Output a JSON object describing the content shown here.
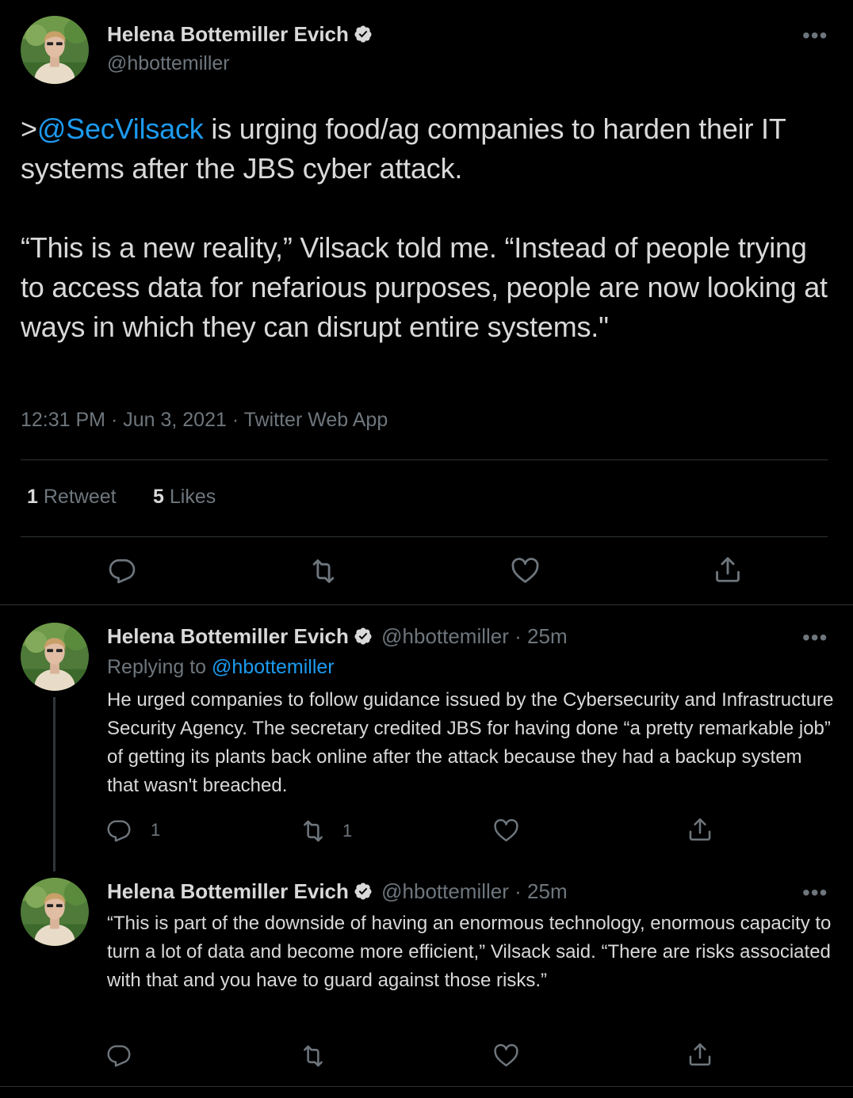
{
  "main_tweet": {
    "author_name": "Helena Bottemiller Evich",
    "handle": "@hbottemiller",
    "text_prefix": ">",
    "mention": "@SecVilsack",
    "text_line1_rest": " is urging food/ag companies to harden their IT systems after the JBS cyber attack.",
    "text_para2": "“This is a new reality,” Vilsack told me. “Instead of people trying to access data for nefarious purposes, people are now looking at ways in which they can disrupt entire systems.\"",
    "timestamp": "12:31 PM · Jun 3, 2021 · Twitter Web App",
    "retweet_count": "1",
    "retweet_label": "Retweet",
    "like_count": "5",
    "like_label": "Likes",
    "more_label": "•••"
  },
  "replies": [
    {
      "author_name": "Helena Bottemiller Evich",
      "handle": "@hbottemiller",
      "time": "· 25m",
      "replying_prefix": "Replying to ",
      "replying_to": "@hbottemiller",
      "text": "He urged companies to follow guidance issued by the Cybersecurity and Infrastructure Security Agency. The secretary credited JBS for having done “a pretty remarkable job” of getting its plants back online after the attack because they had a backup system that wasn't breached.",
      "reply_count": "1",
      "retweet_count": "1",
      "more_label": "•••"
    },
    {
      "author_name": "Helena Bottemiller Evich",
      "handle": "@hbottemiller",
      "time": "· 25m",
      "text": "“This is part of the downside of having an enormous technology, enormous capacity to turn a lot of data and become more efficient,” Vilsack said. “There are risks associated with that and you have to guard against those risks.”",
      "more_label": "•••"
    }
  ],
  "icons": [
    "verified-badge-icon",
    "reply-icon",
    "retweet-icon",
    "like-icon",
    "share-icon",
    "more-icon"
  ],
  "colors": {
    "background": "#000000",
    "text": "#d9d9d9",
    "muted": "#6e767d",
    "link": "#1d9bf0",
    "divider": "#2f3336"
  }
}
